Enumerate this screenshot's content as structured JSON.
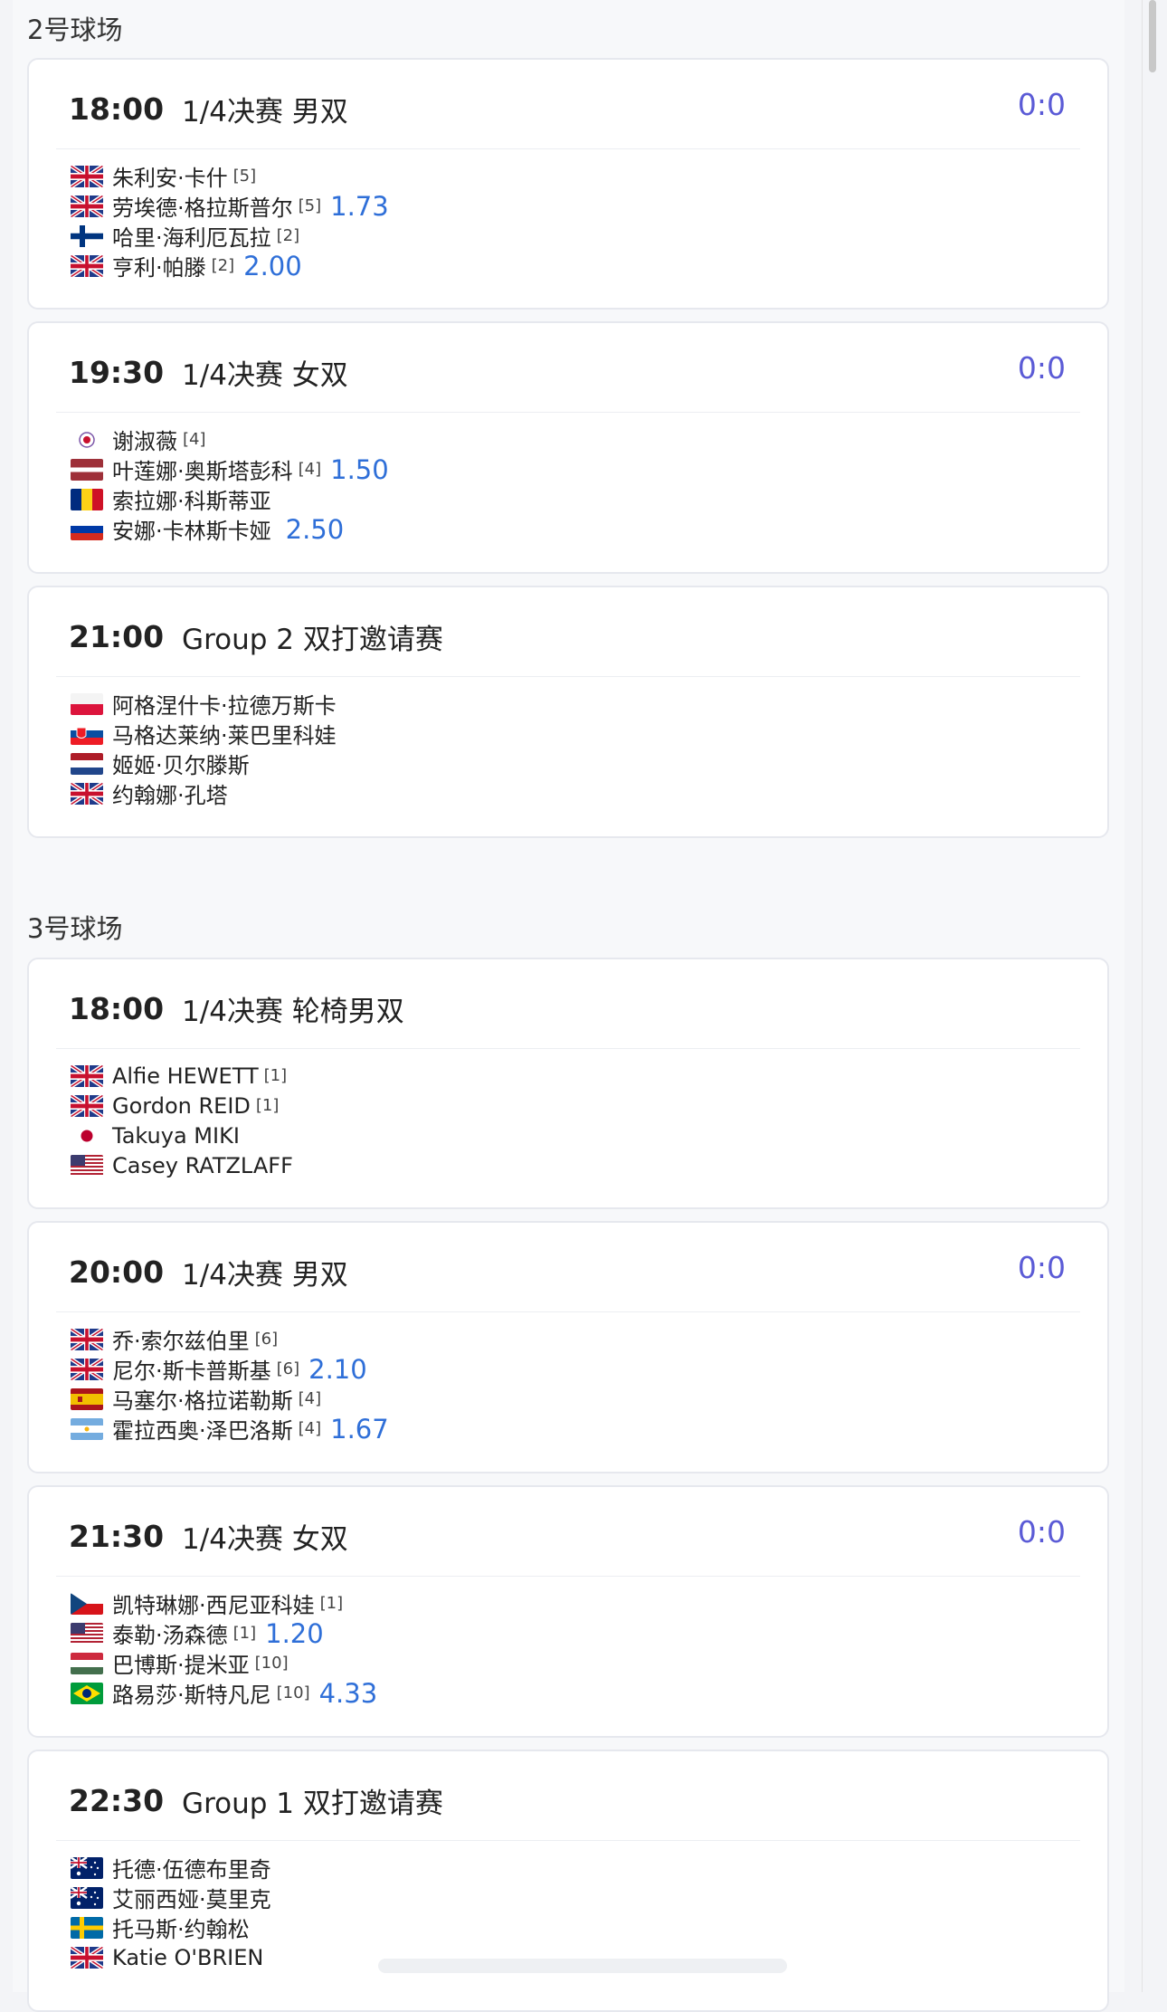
{
  "courts": [
    {
      "name": "2号球场",
      "matches": [
        {
          "time": "18:00",
          "title": "1/4决赛 男双",
          "score": "0:0",
          "players": [
            {
              "flag": "gb",
              "name": "朱利安·卡什",
              "seed": "[5]",
              "odds": ""
            },
            {
              "flag": "gb",
              "name": "劳埃德·格拉斯普尔",
              "seed": "[5]",
              "odds": "1.73"
            },
            {
              "flag": "fi",
              "name": "哈里·海利厄瓦拉",
              "seed": "[2]",
              "odds": ""
            },
            {
              "flag": "gb",
              "name": "亨利·帕滕",
              "seed": "[2]",
              "odds": "2.00"
            }
          ]
        },
        {
          "time": "19:30",
          "title": "1/4决赛 女双",
          "score": "0:0",
          "players": [
            {
              "flag": "tpe",
              "name": "谢淑薇",
              "seed": "[4]",
              "odds": ""
            },
            {
              "flag": "lv",
              "name": "叶莲娜·奥斯塔彭科",
              "seed": "[4]",
              "odds": "1.50"
            },
            {
              "flag": "ro",
              "name": "索拉娜·科斯蒂亚",
              "seed": "",
              "odds": ""
            },
            {
              "flag": "ru",
              "name": "安娜·卡林斯卡娅",
              "seed": "",
              "odds": "2.50"
            }
          ]
        },
        {
          "time": "21:00",
          "title": "Group 2 双打邀请赛",
          "score": "",
          "players": [
            {
              "flag": "pl",
              "name": "阿格涅什卡·拉德万斯卡",
              "seed": "",
              "odds": ""
            },
            {
              "flag": "sk",
              "name": "马格达莱纳·莱巴里科娃",
              "seed": "",
              "odds": ""
            },
            {
              "flag": "nl",
              "name": "姬姬·贝尔滕斯",
              "seed": "",
              "odds": ""
            },
            {
              "flag": "gb",
              "name": "约翰娜·孔塔",
              "seed": "",
              "odds": ""
            }
          ]
        }
      ]
    },
    {
      "name": "3号球场",
      "matches": [
        {
          "time": "18:00",
          "title": "1/4决赛 轮椅男双",
          "score": "",
          "players": [
            {
              "flag": "gb",
              "name": "Alfie HEWETT",
              "seed": "[1]",
              "odds": ""
            },
            {
              "flag": "gb",
              "name": "Gordon REID",
              "seed": "[1]",
              "odds": ""
            },
            {
              "flag": "jp",
              "name": "Takuya MIKI",
              "seed": "",
              "odds": ""
            },
            {
              "flag": "us",
              "name": "Casey RATZLAFF",
              "seed": "",
              "odds": ""
            }
          ]
        },
        {
          "time": "20:00",
          "title": "1/4决赛 男双",
          "score": "0:0",
          "players": [
            {
              "flag": "gb",
              "name": "乔·索尔兹伯里",
              "seed": "[6]",
              "odds": ""
            },
            {
              "flag": "gb",
              "name": "尼尔·斯卡普斯基",
              "seed": "[6]",
              "odds": "2.10"
            },
            {
              "flag": "es",
              "name": "马塞尔·格拉诺勒斯",
              "seed": "[4]",
              "odds": ""
            },
            {
              "flag": "ar",
              "name": "霍拉西奥·泽巴洛斯",
              "seed": "[4]",
              "odds": "1.67"
            }
          ]
        },
        {
          "time": "21:30",
          "title": "1/4决赛 女双",
          "score": "0:0",
          "players": [
            {
              "flag": "cz",
              "name": "凯特琳娜·西尼亚科娃",
              "seed": "[1]",
              "odds": ""
            },
            {
              "flag": "us",
              "name": "泰勒·汤森德",
              "seed": "[1]",
              "odds": "1.20"
            },
            {
              "flag": "hu",
              "name": "巴博斯·提米亚",
              "seed": "[10]",
              "odds": ""
            },
            {
              "flag": "br",
              "name": "路易莎·斯特凡尼",
              "seed": "[10]",
              "odds": "4.33"
            }
          ]
        },
        {
          "time": "22:30",
          "title": "Group 1 双打邀请赛",
          "score": "",
          "players": [
            {
              "flag": "au",
              "name": "托德·伍德布里奇",
              "seed": "",
              "odds": ""
            },
            {
              "flag": "au",
              "name": "艾丽西娅·莫里克",
              "seed": "",
              "odds": ""
            },
            {
              "flag": "se",
              "name": "托马斯·约翰松",
              "seed": "",
              "odds": ""
            },
            {
              "flag": "gb",
              "name": "Katie O'BRIEN",
              "seed": "",
              "odds": ""
            }
          ]
        }
      ]
    }
  ]
}
